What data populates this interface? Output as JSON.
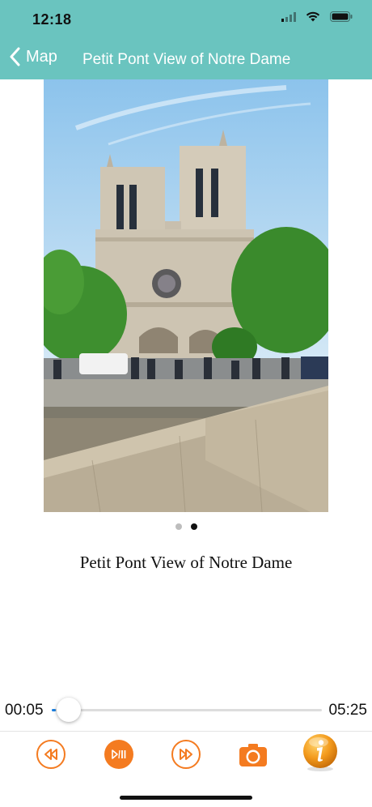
{
  "status": {
    "time": "12:18"
  },
  "nav": {
    "back_label": "Map",
    "title": "Petit Pont View of Notre Dame"
  },
  "carousel": {
    "page_count": 2,
    "active_page": 2
  },
  "caption": "Petit Pont View of Notre Dame",
  "player": {
    "elapsed": "00:05",
    "duration": "05:25",
    "progress": 0.015
  },
  "colors": {
    "header": "#6ac4bf",
    "accent_orange": "#f47b20",
    "progress_blue": "#1a7fe0"
  },
  "icons": {
    "back": "chevron-left-icon",
    "rewind": "rewind-icon",
    "play_pause": "play-pause-icon",
    "forward": "fast-forward-icon",
    "camera": "camera-icon",
    "info": "info-icon"
  }
}
